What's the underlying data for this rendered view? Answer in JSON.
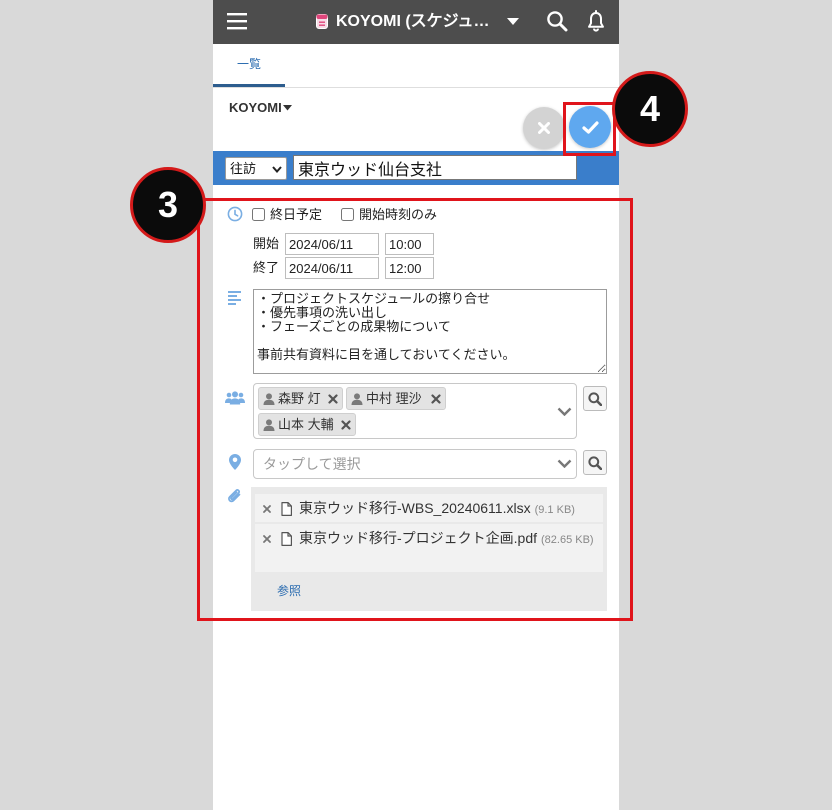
{
  "header": {
    "title": "KOYOMI (スケジュ…"
  },
  "tabs": [
    {
      "label": "一覧",
      "active": true
    }
  ],
  "app_selector": {
    "label": "KOYOMI"
  },
  "event": {
    "visit_type": "往訪",
    "title": "東京ウッド仙台支社",
    "all_day_label": "終日予定",
    "all_day_checked": false,
    "start_time_only_label": "開始時刻のみ",
    "start_time_only_checked": false,
    "start_label": "開始",
    "start_date": "2024/06/11",
    "start_time": "10:00",
    "end_label": "終了",
    "end_date": "2024/06/11",
    "end_time": "12:00",
    "memo": "・プロジェクトスケジュールの擦り合せ\n・優先事項の洗い出し\n・フェーズごとの成果物について\n\n事前共有資料に目を通しておいてください。",
    "participants": [
      "森野 灯",
      "中村 理沙",
      "山本 大輔"
    ],
    "location_placeholder": "タップして選択",
    "attachments": [
      {
        "name": "東京ウッド移行-WBS_20240611.xlsx",
        "size": "(9.1 KB)"
      },
      {
        "name": "東京ウッド移行-プロジェクト企画.pdf",
        "size": "(82.65 KB)"
      }
    ],
    "browse_label": "参照"
  },
  "annotations": [
    {
      "number": "3"
    },
    {
      "number": "4"
    }
  ],
  "icons": {
    "menu": "hamburger-icon",
    "app": "koyomi-app-icon",
    "dropdown": "caret-down-icon",
    "search": "search-icon",
    "notifications": "bell-icon",
    "cancel": "close-icon",
    "confirm": "check-icon",
    "time": "clock-icon",
    "memo": "text-lines-icon",
    "participants": "users-icon",
    "person": "person-icon",
    "location": "map-pin-icon",
    "attachment": "paperclip-icon",
    "file": "file-icon"
  },
  "colors": {
    "header_bg": "#4d4d4d",
    "accent_blue": "#3a7ecb",
    "confirm_blue": "#5fa8ef",
    "link_blue": "#2b6cb0",
    "icon_blue": "#7aaee3",
    "annotation_red": "#e0141b"
  }
}
